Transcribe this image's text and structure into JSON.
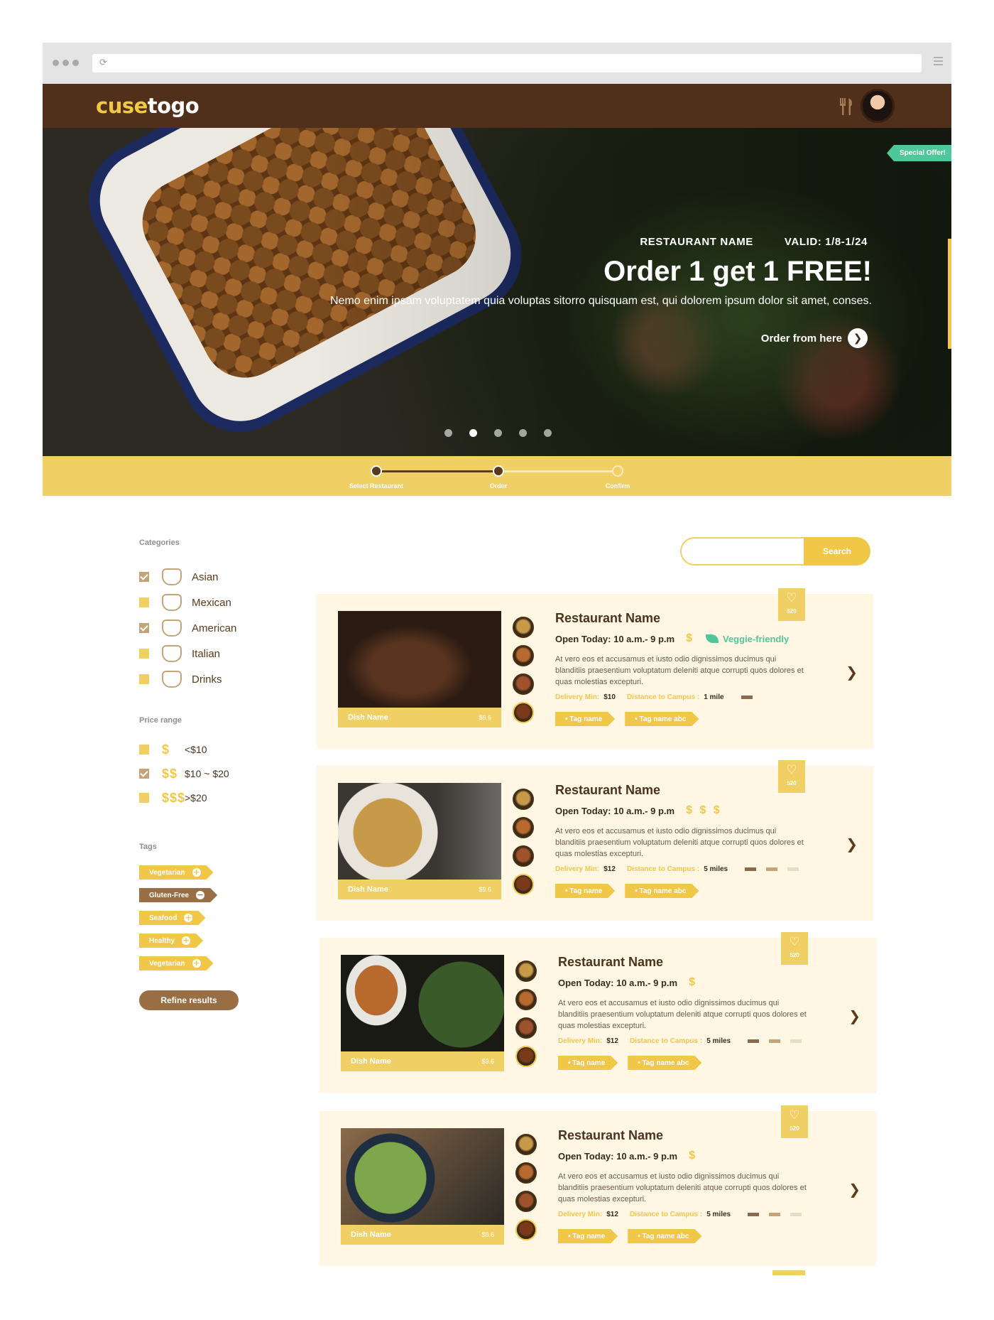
{
  "app": {
    "brand_part1": "cuse",
    "brand_part2": "togo"
  },
  "header": {
    "icons": [
      "utensils-icon",
      "avatar"
    ]
  },
  "hero": {
    "badge": "Special Offer!",
    "restaurant": "RESTAURANT NAME",
    "valid": "VALID: 1/8-1/24",
    "title": "Order 1 get 1 FREE!",
    "description": "Nemo enim ipsam voluptatem quia voluptas sitorro quisquam est, qui dolorem ipsum dolor sit amet, conses.",
    "cta": "Order from here",
    "slides": {
      "count": 5,
      "active": 2
    }
  },
  "steps": [
    {
      "label": "Select Restaurant",
      "state": "done"
    },
    {
      "label": "Order",
      "state": "current"
    },
    {
      "label": "Confirm",
      "state": "pending"
    }
  ],
  "filters": {
    "categories_title": "Categories",
    "categories": [
      {
        "label": "Asian",
        "checked": true,
        "icon": "noodle-bowl-icon"
      },
      {
        "label": "Mexican",
        "checked": false,
        "icon": "taco-icon"
      },
      {
        "label": "American",
        "checked": true,
        "icon": "bread-icon"
      },
      {
        "label": "Italian",
        "checked": false,
        "icon": "pizza-icon"
      },
      {
        "label": "Drinks",
        "checked": false,
        "icon": "drink-cup-icon"
      }
    ],
    "price_title": "Price range",
    "prices": [
      {
        "symbol": "$",
        "label": "<$10",
        "checked": false
      },
      {
        "symbol": "$$",
        "label": "$10 ~ $20",
        "checked": true
      },
      {
        "symbol": "$$$",
        "label": ">$20",
        "checked": false
      }
    ],
    "tags_title": "Tags",
    "tags": [
      {
        "label": "Vegetarian",
        "action": "+",
        "active": false
      },
      {
        "label": "Gluten-Free",
        "action": "−",
        "active": true
      },
      {
        "label": "Seafood",
        "action": "+",
        "active": false
      },
      {
        "label": "Healthy",
        "action": "+",
        "active": false
      },
      {
        "label": "Vegetarian",
        "action": "+",
        "active": false
      }
    ],
    "refine_label": "Refine results"
  },
  "search": {
    "button": "Search",
    "placeholder": ""
  },
  "labels": {
    "delivery": "Delivery Min:",
    "distance": "Distance to Campus :",
    "tag1": "Tag name",
    "tag2": "Tag name abc",
    "dish_name": "Dish Name",
    "dish_price": "$9.6",
    "heart_count": "520",
    "description": "At vero eos et accusamus et iusto odio dignissimos ducimus qui blanditiis praesentium voluptatum deleniti atque corrupti quos dolores et quas molestias excepturi."
  },
  "restaurants": [
    {
      "name": "Restaurant Name",
      "hours": "Open Today: 10 a.m.- 9 p.m",
      "cost": "$",
      "veggie": "Veggie-friendly",
      "delivery_min": "$10",
      "distance": "1 mile",
      "distance_level": 1
    },
    {
      "name": "Restaurant Name",
      "hours": "Open Today: 10 a.m.- 9 p.m",
      "cost": "$ $ $",
      "veggie": "",
      "delivery_min": "$12",
      "distance": "5 miles",
      "distance_level": 2
    },
    {
      "name": "Restaurant Name",
      "hours": "Open Today: 10 a.m.- 9 p.m",
      "cost": "$",
      "veggie": "",
      "delivery_min": "$12",
      "distance": "5 miles",
      "distance_level": 2
    },
    {
      "name": "Restaurant Name",
      "hours": "Open Today: 10 a.m.- 9 p.m",
      "cost": "$",
      "veggie": "",
      "delivery_min": "$12",
      "distance": "5 miles",
      "distance_level": 2
    }
  ],
  "colors": {
    "brand_brown": "#50301a",
    "accent_yellow": "#f0c747",
    "card_bg": "#fff7e3",
    "veggie_green": "#4ec79b"
  }
}
